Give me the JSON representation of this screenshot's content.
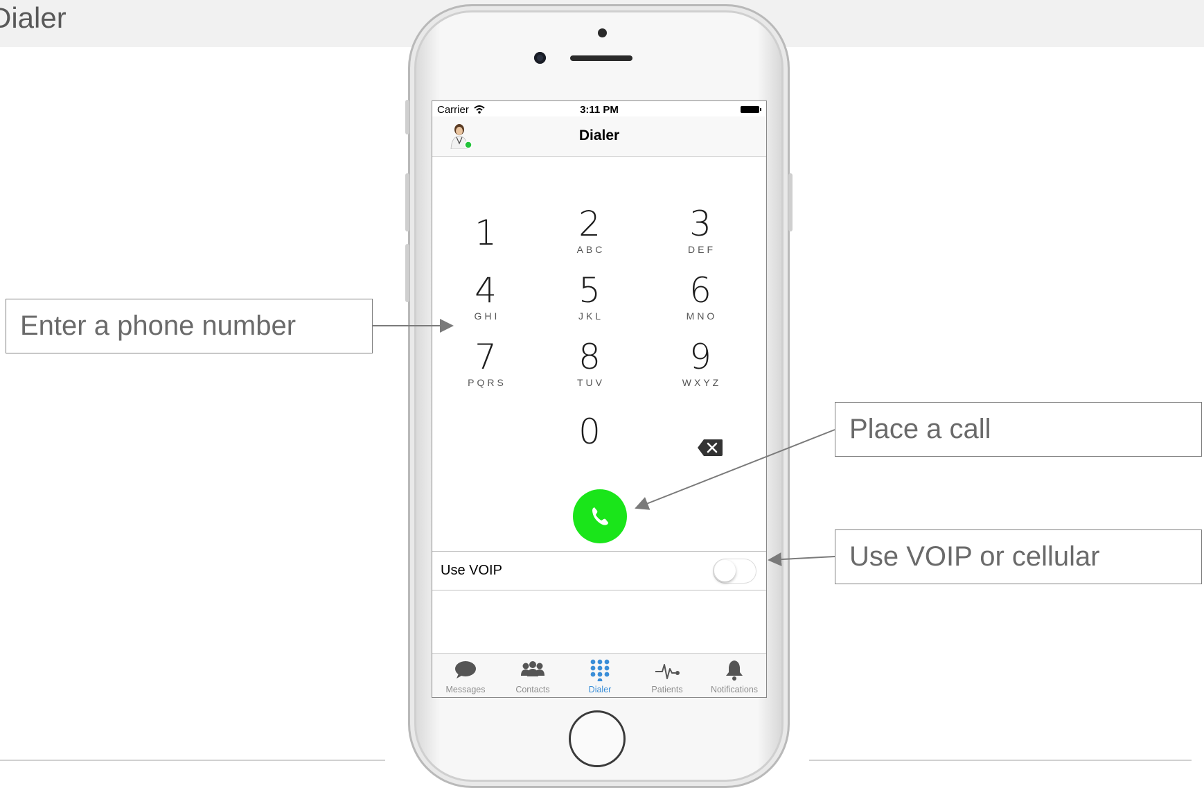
{
  "slide": {
    "title": "Dialer"
  },
  "callouts": {
    "enter_number": "Enter a phone number",
    "place_call": "Place a call",
    "voip": "Use VOIP or cellular"
  },
  "status_bar": {
    "carrier": "Carrier",
    "time": "3:11 PM"
  },
  "nav": {
    "title": "Dialer"
  },
  "keypad": [
    {
      "digit": "1",
      "letters": ""
    },
    {
      "digit": "2",
      "letters": "ABC"
    },
    {
      "digit": "3",
      "letters": "DEF"
    },
    {
      "digit": "4",
      "letters": "GHI"
    },
    {
      "digit": "5",
      "letters": "JKL"
    },
    {
      "digit": "6",
      "letters": "MNO"
    },
    {
      "digit": "7",
      "letters": "PQRS"
    },
    {
      "digit": "8",
      "letters": "TUV"
    },
    {
      "digit": "9",
      "letters": "WXYZ"
    },
    {
      "digit": "0",
      "letters": ""
    }
  ],
  "voip": {
    "label": "Use VOIP",
    "enabled": false
  },
  "tabs": [
    {
      "label": "Messages",
      "icon": "chat-bubble-icon"
    },
    {
      "label": "Contacts",
      "icon": "people-icon"
    },
    {
      "label": "Dialer",
      "icon": "keypad-icon",
      "active": true
    },
    {
      "label": "Patients",
      "icon": "heartbeat-icon"
    },
    {
      "label": "Notifications",
      "icon": "bell-icon"
    }
  ],
  "colors": {
    "call_green": "#1ae51a",
    "tab_active": "#3a8ed8",
    "presence_online": "#22c33a"
  }
}
